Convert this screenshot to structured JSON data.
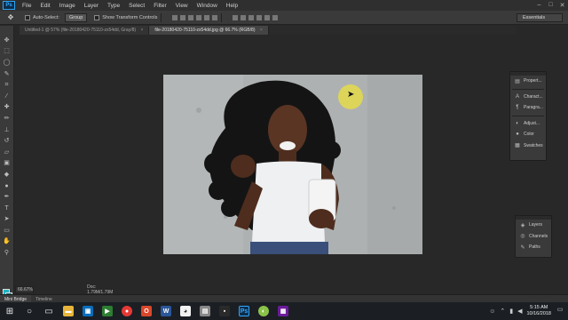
{
  "menubar": {
    "logo": "Ps",
    "items": [
      "File",
      "Edit",
      "Image",
      "Layer",
      "Type",
      "Select",
      "Filter",
      "View",
      "Window",
      "Help"
    ],
    "window_controls": [
      "–",
      "□",
      "✕"
    ]
  },
  "options": {
    "auto_select_label": "Auto-Select:",
    "auto_select_value": "Group",
    "show_transform_label": "Show Transform Controls",
    "workspace": "Essentials"
  },
  "tabs": [
    {
      "label": "Untitled-1 @ 57% (file-20180420-75110-zx54dd, Gray/8)",
      "close": "×",
      "active": false
    },
    {
      "label": "file-20180420-75110-zx54dd.jpg @ 66.7% (RGB/8)",
      "close": "×",
      "active": true
    }
  ],
  "status": {
    "zoom": "66.67%",
    "doc": "Doc: 1.79M/1.79M"
  },
  "minibar": {
    "tabs": [
      "Mini Bridge",
      "Timeline"
    ]
  },
  "dock_top": {
    "items": [
      {
        "icon": "properties-icon",
        "glyph": "▤",
        "label": "Propert..."
      },
      {
        "icon": "character-icon",
        "glyph": "A",
        "label": "Charact..."
      },
      {
        "icon": "paragraph-icon",
        "glyph": "¶",
        "label": "Paragra..."
      },
      {
        "icon": "adjustments-icon",
        "glyph": "◐",
        "label": "Adjust..."
      },
      {
        "icon": "color-icon",
        "glyph": "●",
        "label": "Color"
      },
      {
        "icon": "swatches-icon",
        "glyph": "▦",
        "label": "Swatches"
      }
    ]
  },
  "dock_bottom": {
    "items": [
      {
        "icon": "layers-icon",
        "glyph": "◈",
        "label": "Layers"
      },
      {
        "icon": "channels-icon",
        "glyph": "◎",
        "label": "Channels"
      },
      {
        "icon": "paths-icon",
        "glyph": "✎",
        "label": "Paths"
      }
    ]
  },
  "taskbar": {
    "time": "5:15 AM",
    "date": "10/16/2018"
  },
  "colors": {
    "foreground": "#1fb3c4",
    "background": "#1a6f7d",
    "accent": "#31a8ff"
  }
}
